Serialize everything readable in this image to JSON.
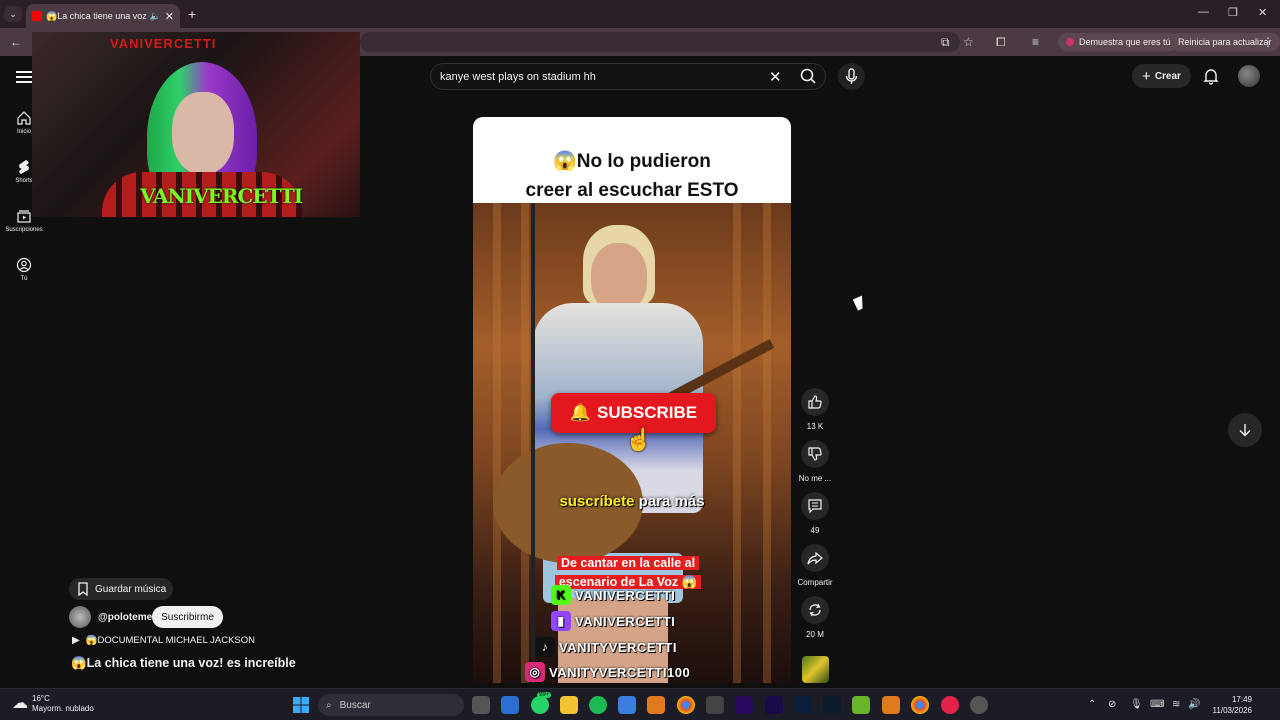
{
  "browser": {
    "tab_title": "😱La chica tiene una voz! e",
    "notice_label": "Demuestra que eres tú",
    "update_label": "Reinicia para actualizar"
  },
  "webcam": {
    "logo_top": "VANIVERCETTI",
    "logo_bottom": "VANIVERCETTI"
  },
  "youtube": {
    "search_value": "kanye west plays on stadium hh",
    "create_label": "Crear",
    "sidebar": [
      {
        "label": "Inicio",
        "icon": "home-icon"
      },
      {
        "label": "Shorts",
        "icon": "shorts-icon"
      },
      {
        "label": "Suscripciones",
        "icon": "subscriptions-icon"
      },
      {
        "label": "Tú",
        "icon": "you-icon"
      }
    ],
    "video": {
      "header_line1": "😱No lo pudieron",
      "header_line2": "creer al escuchar ESTO",
      "subscribe_label": "SUBSCRIBE",
      "caption_highlight": "suscríbete",
      "caption_rest": "para más",
      "red_line1": "De cantar en la calle al",
      "red_line2": "escenario de La Voz 😱",
      "socials": [
        {
          "handle": "VANIVERCETTI",
          "icon": "kick-icon",
          "color": "#53fc18"
        },
        {
          "handle": "VANIVERCETTI",
          "icon": "twitch-icon",
          "color": "#9146ff"
        },
        {
          "handle": "VANITYVERCETTI",
          "icon": "tiktok-icon",
          "color": "#111111"
        },
        {
          "handle": "VANITYVERCETTI100",
          "icon": "instagram-icon",
          "color": "#d62976"
        }
      ]
    },
    "actions": {
      "likes": "13 K",
      "dislike_label": "No me ...",
      "comments": "49",
      "share_label": "Compartir",
      "remix_count": "20 M"
    },
    "info": {
      "save_music_label": "Guardar música",
      "channel": "@poloteme",
      "subscribe_label": "Suscribirme",
      "playlist": "😱DOCUMENTAL MICHAEL JACKSON",
      "title": "😱La chica tiene una voz! es increíble"
    }
  },
  "taskbar": {
    "temperature": "16°C",
    "weather": "Mayorm. nublado",
    "search_placeholder": "Buscar",
    "badge": "99+",
    "time": "17:49",
    "date": "11/03/2026"
  },
  "colors": {
    "accent_red": "#e2181e",
    "background": "#0f0f0f"
  }
}
